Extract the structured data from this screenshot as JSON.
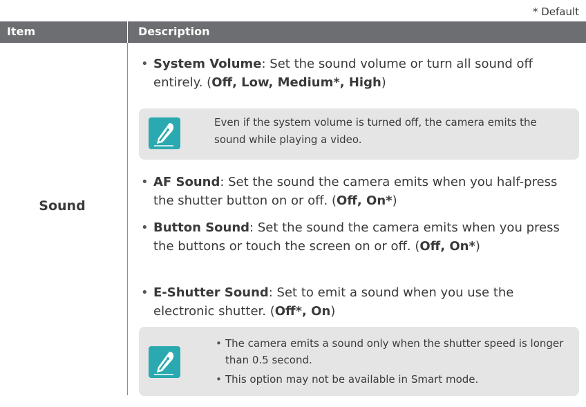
{
  "default_note": "* Default",
  "table": {
    "headers": {
      "item": "Item",
      "description": "Description"
    },
    "item": "Sound",
    "bullets": [
      {
        "term": "System Volume",
        "text": ": Set the sound volume or turn all sound off entirely. (",
        "options": "Off, Low, Medium*, High"
      },
      {
        "term": "AF Sound",
        "text": ": Set the sound the camera emits when you half-press the shutter button on or off. (",
        "options": "Off, On*"
      },
      {
        "term": "Button Sound",
        "text": ": Set the sound the camera emits when you press the buttons or touch the screen on or off. (",
        "options": "Off, On*"
      },
      {
        "term": "E-Shutter Sound",
        "text": ": Set to emit a sound when you use the electronic shutter. (",
        "options": "Off*, On"
      }
    ],
    "note1": "Even if the system volume is turned off, the camera emits the sound while playing a video.",
    "note2": [
      "The camera emits a sound only when the shutter speed is longer than 0.5 second.",
      "This option may not be available in Smart mode."
    ],
    "note_icon": "note-pen-icon",
    "accent_color": "#2aaab0",
    "header_color": "#6d6e71",
    "note_bg": "#e5e5e6"
  }
}
